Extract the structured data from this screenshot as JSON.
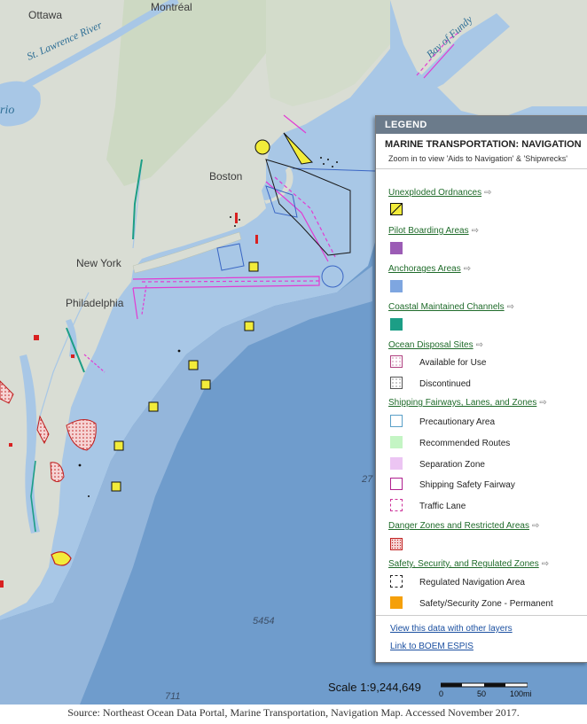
{
  "map": {
    "places": {
      "ottawa": "Ottawa",
      "montreal": "Montréal",
      "boston": "Boston",
      "new_york": "New York",
      "philadelphia": "Philadelphia"
    },
    "water": {
      "st_lawrence": "St. Lawrence River",
      "bay_of_fundy": "Bay of Fundy",
      "ontario": "rio"
    },
    "depths": {
      "d1": "27",
      "d2": "5454",
      "d3": "711"
    },
    "colors": {
      "land": "#d8dcd4",
      "forest": "#c9d8c0",
      "water_shelf": "#a9c8e4",
      "water_deep": "#7fa6cf",
      "fairway": "#e23bd3",
      "anchorage": "#3a66c4"
    }
  },
  "legend": {
    "header": "LEGEND",
    "title": "MARINE TRANSPORTATION: NAVIGATION",
    "hint": "Zoom in to view 'Aids to Navigation' & 'Shipwrecks'",
    "sections": {
      "uxo": "Unexploded Ordnances",
      "pilot": "Pilot Boarding Areas",
      "anchorage": "Anchorages Areas",
      "channels": "Coastal Maintained Channels",
      "disposal": "Ocean Disposal Sites",
      "fairways": "Shipping Fairways, Lanes, and Zones",
      "danger": "Danger Zones and Restricted Areas",
      "safety": "Safety, Security, and Regulated Zones"
    },
    "items": {
      "available": "Available for Use",
      "discontinued": "Discontinued",
      "precautionary": "Precautionary Area",
      "recommended": "Recommended Routes",
      "separation": "Separation Zone",
      "safety_fairway": "Shipping Safety Fairway",
      "traffic_lane": "Traffic Lane",
      "regulated": "Regulated Navigation Area",
      "security_zone": "Safety/Security Zone - Permanent"
    },
    "links": {
      "other_layers": "View this data with other layers",
      "espis": "Link to BOEM ESPIS"
    },
    "swatch_colors": {
      "uxo": "#f2ec3a",
      "pilot": "#9b5cb5",
      "anchorage": "#7ea6e0",
      "channels": "#1c9e86",
      "recommended": "#c4f5c4",
      "separation": "#ecc5f3",
      "fairway_border": "#b0208f",
      "traffic_border": "#cc3399",
      "danger": "#d83030",
      "security": "#f5a00a"
    }
  },
  "scale": {
    "label": "Scale 1:9,244,649",
    "ticks": [
      "0",
      "50",
      "100mi"
    ]
  },
  "caption": "Source: Northeast Ocean Data Portal, Marine Transportation, Navigation Map.  Accessed November 2017."
}
